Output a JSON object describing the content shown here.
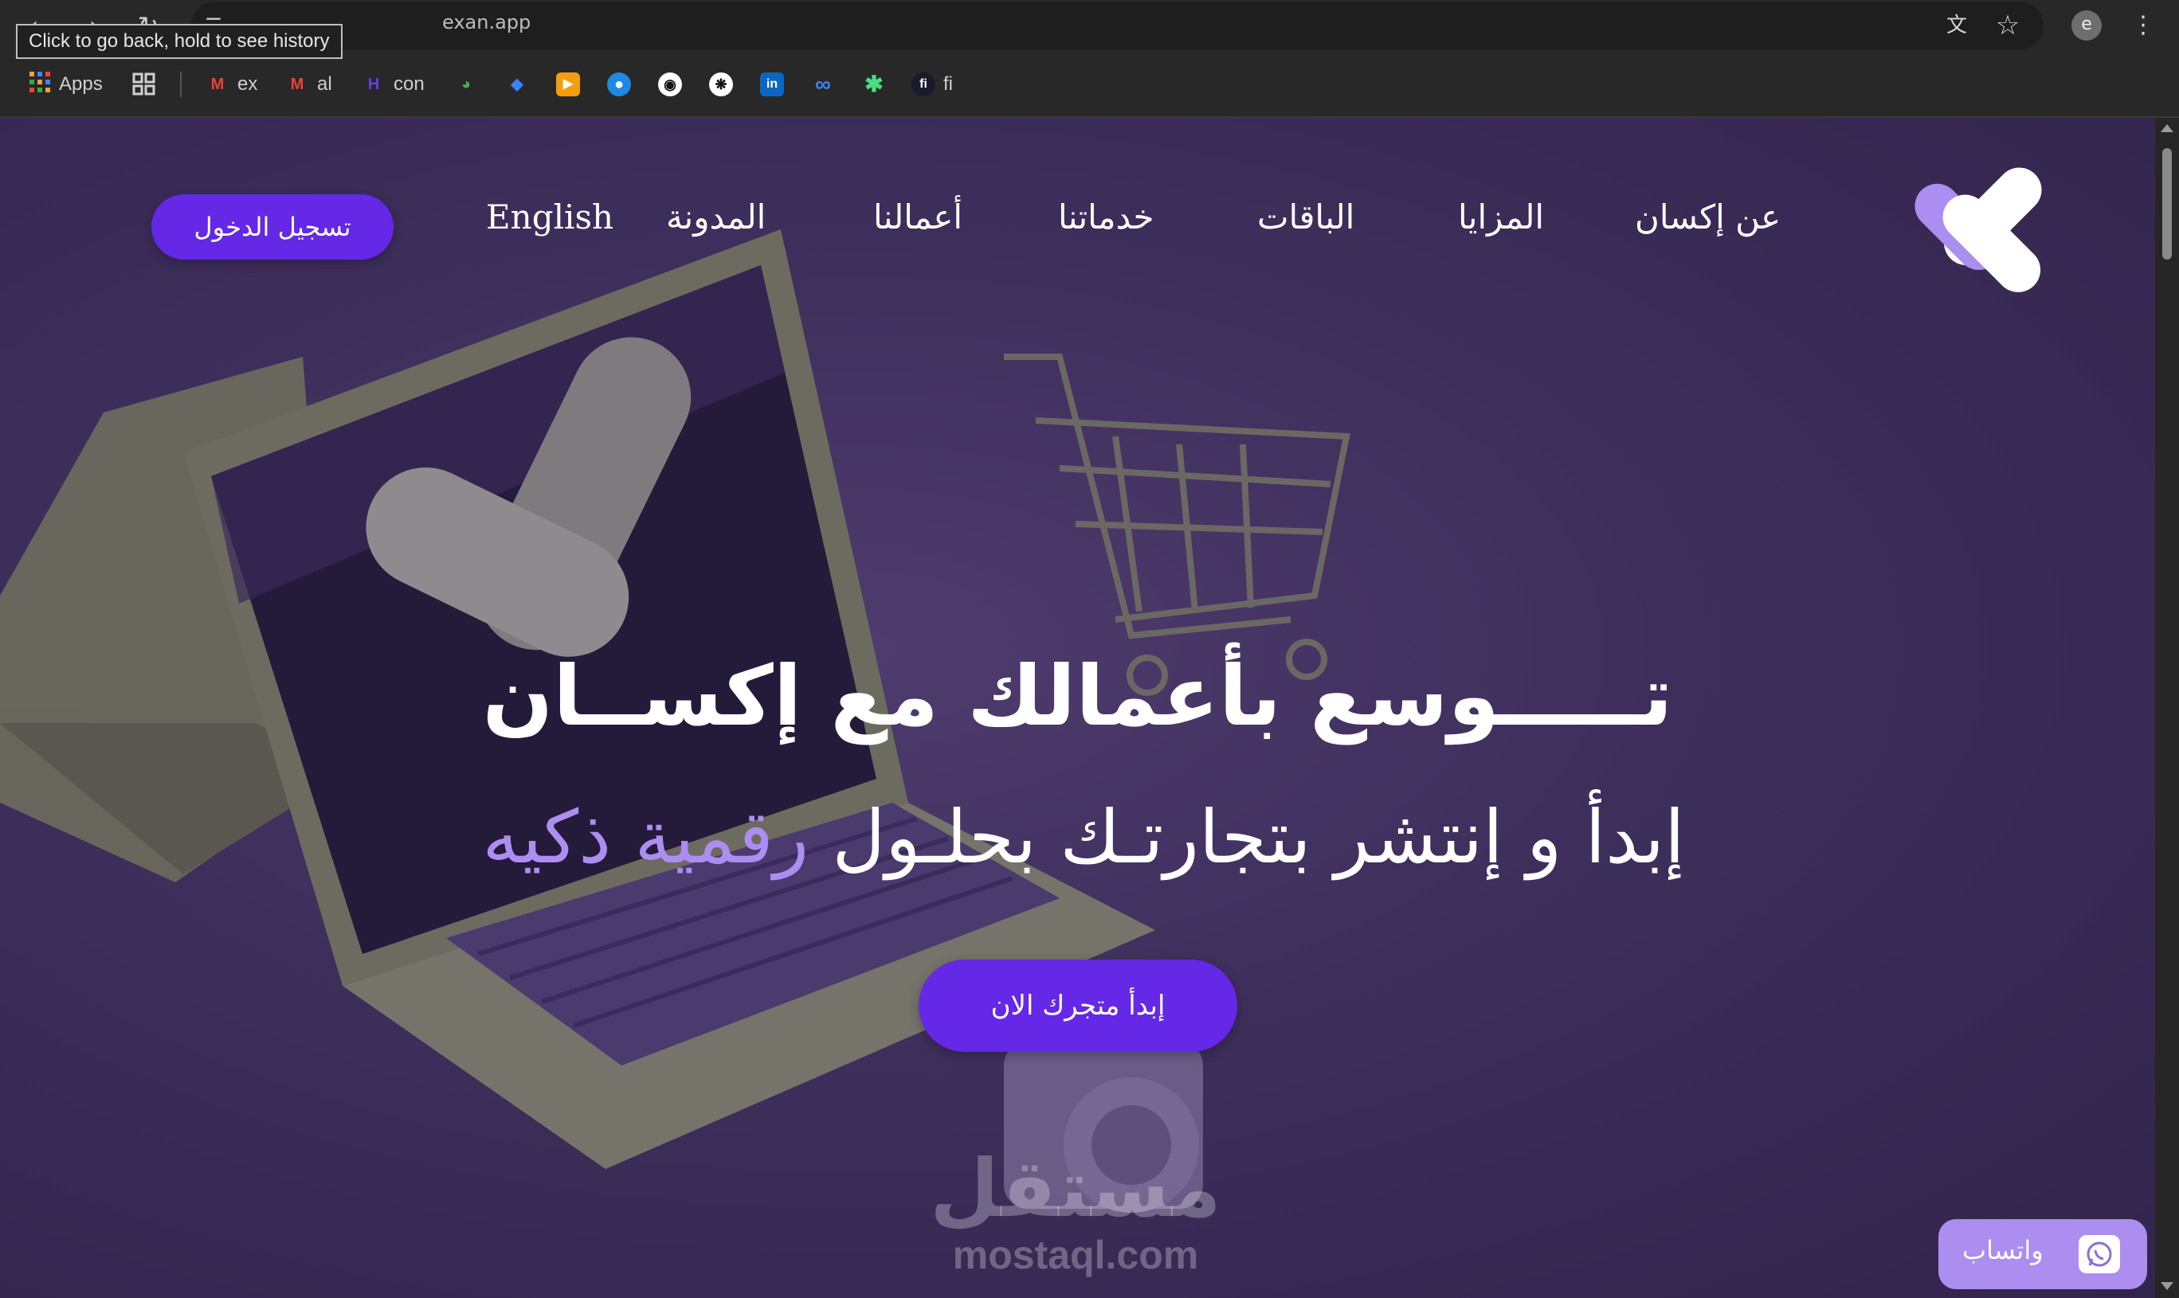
{
  "browser": {
    "url": "exan.app",
    "tooltip": "Click to go back, hold to see history",
    "avatar_letter": "e",
    "icons": [
      "back-arrow-icon",
      "forward-arrow-icon",
      "reload-icon",
      "site-info-icon",
      "translate-icon",
      "star-icon",
      "more-vert-icon"
    ],
    "bookmarks": [
      {
        "label": "Apps",
        "icon": "apps-grid-icon"
      },
      {
        "label": "",
        "icon": "tab-groups-icon"
      },
      {
        "label": "ex",
        "icon": "gmail-icon"
      },
      {
        "label": "al",
        "icon": "gmail-icon"
      },
      {
        "label": "con",
        "icon": "hostinger-icon"
      },
      {
        "label": "",
        "icon": "green-bookmark-icon"
      },
      {
        "label": "",
        "icon": "blue-diamond-icon"
      },
      {
        "label": "",
        "icon": "orange-play-icon"
      },
      {
        "label": "",
        "icon": "blue-circle-icon"
      },
      {
        "label": "",
        "icon": "github-icon"
      },
      {
        "label": "",
        "icon": "openai-icon"
      },
      {
        "label": "",
        "icon": "linkedin-icon"
      },
      {
        "label": "",
        "icon": "meta-icon"
      },
      {
        "label": "",
        "icon": "green-star-icon"
      },
      {
        "label": "fi",
        "icon": "fi-icon"
      }
    ]
  },
  "site": {
    "nav": {
      "items": [
        "عن إكسان",
        "المزايا",
        "الباقات",
        "خدماتنا",
        "أعمالنا",
        "المدونة",
        "English"
      ],
      "login": "تسجيل الدخول"
    },
    "hero": {
      "title": "تـــــوسع بأعمالك مع إكســان",
      "subtitle_plain": "إبدأ و إنتشر بتجارتـك بحلـول",
      "subtitle_accent": "رقمية ذكيه",
      "cta": "إبدأ متجرك الان"
    },
    "watermark": {
      "arabic": "مستقل",
      "latin": "mostaql.com"
    },
    "whatsapp": {
      "label": "واتساب",
      "icon": "whatsapp-icon"
    },
    "colors": {
      "primary": "#6428e6",
      "accent": "#ac8df0",
      "background": "#3d2e5b"
    }
  }
}
